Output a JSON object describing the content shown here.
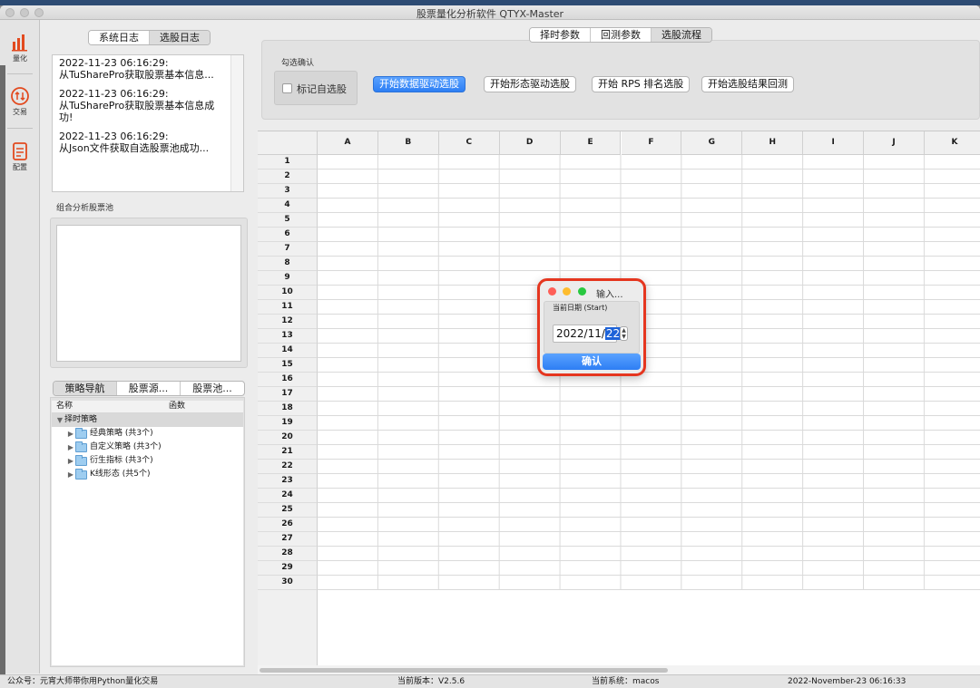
{
  "window": {
    "title": "股票量化分析软件 QTYX-Master"
  },
  "toolbar": [
    {
      "label": "量化",
      "icon": "bar-chart-icon"
    },
    {
      "label": "交易",
      "icon": "trade-arrows-icon"
    },
    {
      "label": "配置",
      "icon": "document-icon"
    }
  ],
  "log": {
    "tabs": [
      "系统日志",
      "选股日志"
    ],
    "entries": [
      {
        "time": "2022-11-23 06:16:29:",
        "message": "从TuSharePro获取股票基本信息..."
      },
      {
        "time": "2022-11-23 06:16:29:",
        "message": "从TuSharePro获取股票基本信息成功!"
      },
      {
        "time": "2022-11-23 06:16:29:",
        "message": "从Json文件获取自选股票池成功..."
      }
    ]
  },
  "pool": {
    "label": "组合分析股票池"
  },
  "nav": {
    "tabs": [
      "策略导航",
      "股票源...",
      "股票池..."
    ],
    "columns": [
      "名称",
      "函数"
    ],
    "root": "择时策略",
    "folders": [
      "经典策略 (共3个)",
      "自定义策略 (共3个)",
      "衍生指标 (共3个)",
      "K线形态 (共5个)"
    ]
  },
  "main": {
    "tabs": [
      "择时参数",
      "回测参数",
      "选股流程"
    ],
    "confirm_group": "勾选确认",
    "checkbox_label": "标记自选股",
    "buttons": [
      "开始数据驱动选股",
      "开始形态驱动选股",
      "开始 RPS 排名选股",
      "开始选股结果回测"
    ]
  },
  "sheet": {
    "columns": [
      "A",
      "B",
      "C",
      "D",
      "E",
      "F",
      "G",
      "H",
      "I",
      "J",
      "K"
    ],
    "rows": [
      "1",
      "2",
      "3",
      "4",
      "5",
      "6",
      "7",
      "8",
      "9",
      "10",
      "11",
      "12",
      "13",
      "14",
      "15",
      "16",
      "17",
      "18",
      "19",
      "20",
      "21",
      "22",
      "23",
      "24",
      "25",
      "26",
      "27",
      "28",
      "29",
      "30"
    ]
  },
  "dialog": {
    "title": "输入...",
    "label": "当前日期 (Start)",
    "date_prefix": "2022/11/",
    "date_day": "22",
    "ok": "确认"
  },
  "status": {
    "account": "公众号：元宵大师带你用Python量化交易",
    "version": "当前版本：V2.5.6",
    "system": "当前系统：macos",
    "datetime": "2022-November-23 06:16:33"
  },
  "colors": {
    "accent": "#2d7ef4",
    "highlight_ring": "#e5361f",
    "tool_icon": "#e24a1f"
  }
}
